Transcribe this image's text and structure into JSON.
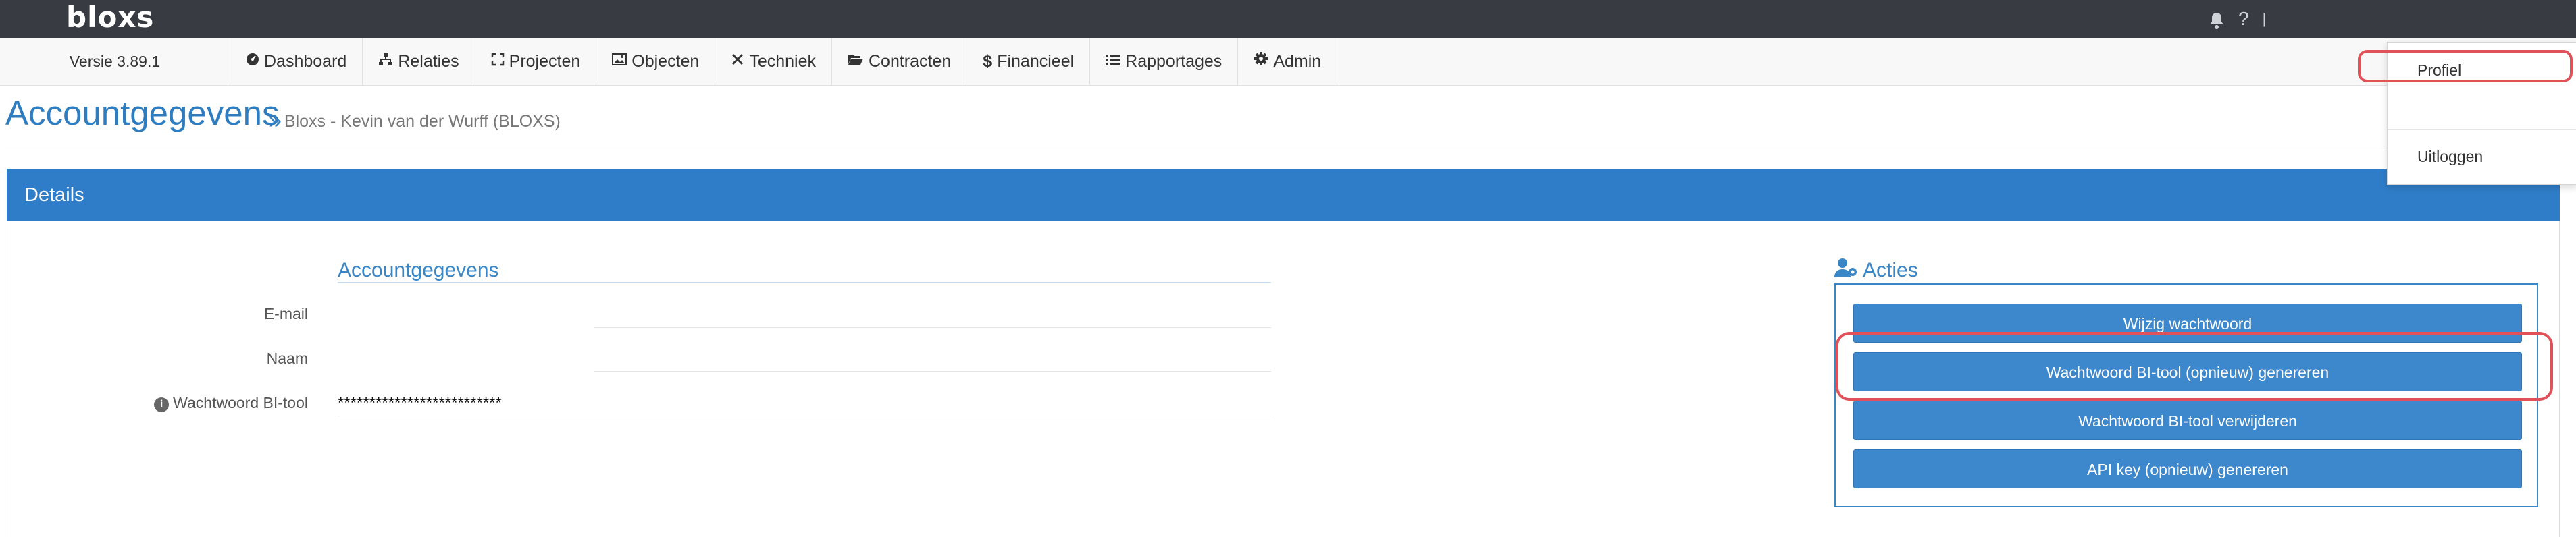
{
  "app": {
    "logo": "bloxs",
    "version": "Versie 3.89.1"
  },
  "topbar": {
    "icons": [
      "bell-icon",
      "question-icon"
    ],
    "question": "?",
    "separator": "|"
  },
  "nav": {
    "items": [
      {
        "label": "Dashboard",
        "icon": "dashboard-icon"
      },
      {
        "label": "Relaties",
        "icon": "sitemap-icon"
      },
      {
        "label": "Projecten",
        "icon": "expand-icon"
      },
      {
        "label": "Objecten",
        "icon": "image-icon"
      },
      {
        "label": "Techniek",
        "icon": "wrench-icon"
      },
      {
        "label": "Contracten",
        "icon": "folder-open-icon"
      },
      {
        "label": "Financieel",
        "icon": "dollar-icon"
      },
      {
        "label": "Rapportages",
        "icon": "list-icon"
      },
      {
        "label": "Admin",
        "icon": "gear-icon"
      }
    ]
  },
  "dropdown": {
    "profile": "Profiel",
    "logout": "Uitloggen"
  },
  "page": {
    "title": "Accountgegevens",
    "breadcrumb_sep": "»",
    "breadcrumb": "Bloxs - Kevin van der Wurff (BLOXS)"
  },
  "panel": {
    "title": "Details"
  },
  "account": {
    "title": "Accountgegevens",
    "email_label": "E-mail",
    "email_value": "",
    "name_label": "Naam",
    "name_value": "",
    "pw_label": "Wachtwoord BI-tool",
    "pw_value": "**************************"
  },
  "actions": {
    "title": "Acties",
    "buttons": [
      "Wijzig wachtwoord",
      "Wachtwoord BI-tool (opnieuw) genereren",
      "Wachtwoord BI-tool verwijderen",
      "API key (opnieuw) genereren"
    ]
  },
  "colors": {
    "accent": "#2f7dc8",
    "topbar": "#383c42",
    "highlight": "#e0515a"
  }
}
